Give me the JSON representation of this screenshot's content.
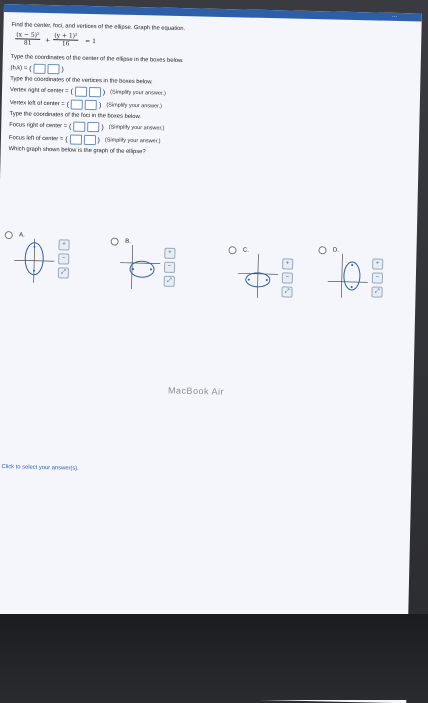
{
  "top_bar": {
    "text": "…"
  },
  "question": {
    "prompt": "Find the center, foci, and vertices of the ellipse. Graph the equation.",
    "equation": {
      "term1_num": "(x − 5)²",
      "term1_den": "81",
      "plus": "+",
      "term2_num": "(y + 1)²",
      "term2_den": "16",
      "equals": "= 1"
    },
    "center_instruction": "Type the coordinates of the center of the ellipse in the boxes below.",
    "center_label": "(h,k) =",
    "vertices_instruction": "Type the coordinates of the vertices in the boxes below.",
    "vertex_right_label": "Vertex right of center =",
    "vertex_left_label": "Vertex left of center =",
    "foci_instruction": "Type the coordinates of the foci in the boxes below.",
    "focus_right_label": "Focus right of center =",
    "focus_left_label": "Focus left of center =",
    "simplify_hint": "(Simplify your answer.)",
    "graph_question": "Which graph shown below is the graph of the ellipse?"
  },
  "options": [
    {
      "label": "A."
    },
    {
      "label": "B."
    },
    {
      "label": "C."
    },
    {
      "label": "D."
    }
  ],
  "footer": {
    "link_text": "Click to select your answer(s)."
  },
  "device": {
    "brand_text": "MacBook Air"
  },
  "colors": {
    "accent": "#2d5fa8",
    "box_border": "#6a8fc0"
  }
}
